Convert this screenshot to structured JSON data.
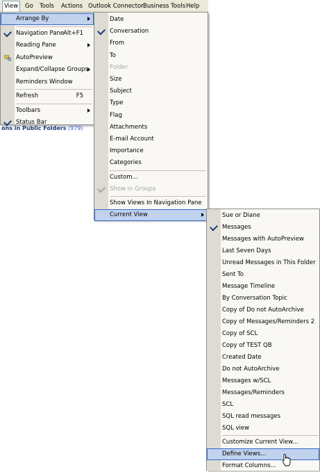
{
  "menubar": [
    "View",
    "Go",
    "Tools",
    "Actions",
    "Outlook Connector",
    "Business Tools",
    "Help"
  ],
  "view_menu": [
    {
      "label": "Arrange By",
      "submenu": true,
      "selected": true
    },
    {
      "separator": true
    },
    {
      "label": "Navigation Pane",
      "shortcut": "Alt+F1",
      "checked": true
    },
    {
      "label": "Reading Pane",
      "submenu": true
    },
    {
      "label": "AutoPreview",
      "icon": "autopreview-icon"
    },
    {
      "label": "Expand/Collapse Groups",
      "submenu": true
    },
    {
      "label": "Reminders Window"
    },
    {
      "separator": true
    },
    {
      "label": "Refresh",
      "shortcut": "F5"
    },
    {
      "separator": true
    },
    {
      "label": "Toolbars",
      "submenu": true
    },
    {
      "label": "Status Bar",
      "checked": true
    }
  ],
  "arrange_menu": [
    {
      "label": "Date"
    },
    {
      "label": "Conversation",
      "checked": true
    },
    {
      "label": "From"
    },
    {
      "label": "To"
    },
    {
      "label": "Folder",
      "disabled": true
    },
    {
      "label": "Size"
    },
    {
      "label": "Subject"
    },
    {
      "label": "Type"
    },
    {
      "label": "Flag"
    },
    {
      "label": "Attachments"
    },
    {
      "label": "E-mail Account"
    },
    {
      "label": "Importance"
    },
    {
      "label": "Categories"
    },
    {
      "separator": true
    },
    {
      "label": "Custom..."
    },
    {
      "label": "Show in Groups",
      "checked": true,
      "disabled": true
    },
    {
      "separator": true
    },
    {
      "label": "Show Views In Navigation Pane"
    },
    {
      "label": "Current View",
      "submenu": true,
      "selected": true
    }
  ],
  "current_view_menu": [
    {
      "label": "Sue or Diane"
    },
    {
      "label": "Messages",
      "checked": true
    },
    {
      "label": "Messages with AutoPreview"
    },
    {
      "label": "Last Seven Days"
    },
    {
      "label": "Unread Messages in This Folder"
    },
    {
      "label": "Sent To"
    },
    {
      "label": "Message Timeline"
    },
    {
      "label": "By Conversation Topic"
    },
    {
      "label": "Copy of Do not AutoArchive"
    },
    {
      "label": "Copy of Messages/Reminders 2"
    },
    {
      "label": "Copy of SCL"
    },
    {
      "label": "Copy of TEST QB"
    },
    {
      "label": "Created Date"
    },
    {
      "label": "Do not AutoArchive"
    },
    {
      "label": "Messages w/SCL"
    },
    {
      "label": "Messages/Reminders"
    },
    {
      "label": "SCL"
    },
    {
      "label": "SQL read messages"
    },
    {
      "label": "SQL view"
    },
    {
      "separator": true
    },
    {
      "label": "Customize Current View..."
    },
    {
      "label": "Define Views...",
      "selected": true
    },
    {
      "label": "Format Columns..."
    }
  ],
  "background": {
    "folder_text": "ons in Public Folders",
    "count": "(979)"
  }
}
